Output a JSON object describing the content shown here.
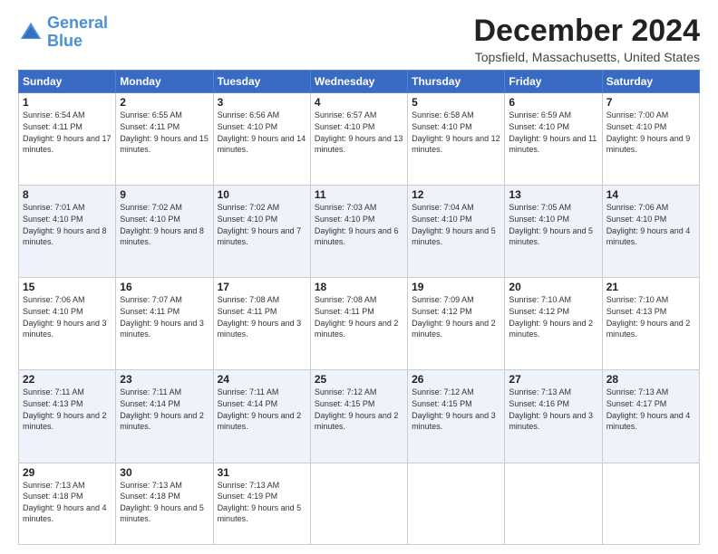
{
  "logo": {
    "line1": "General",
    "line2": "Blue"
  },
  "title": "December 2024",
  "location": "Topsfield, Massachusetts, United States",
  "days_of_week": [
    "Sunday",
    "Monday",
    "Tuesday",
    "Wednesday",
    "Thursday",
    "Friday",
    "Saturday"
  ],
  "weeks": [
    [
      {
        "num": "1",
        "sunrise": "6:54 AM",
        "sunset": "4:11 PM",
        "daylight": "9 hours and 17 minutes."
      },
      {
        "num": "2",
        "sunrise": "6:55 AM",
        "sunset": "4:11 PM",
        "daylight": "9 hours and 15 minutes."
      },
      {
        "num": "3",
        "sunrise": "6:56 AM",
        "sunset": "4:10 PM",
        "daylight": "9 hours and 14 minutes."
      },
      {
        "num": "4",
        "sunrise": "6:57 AM",
        "sunset": "4:10 PM",
        "daylight": "9 hours and 13 minutes."
      },
      {
        "num": "5",
        "sunrise": "6:58 AM",
        "sunset": "4:10 PM",
        "daylight": "9 hours and 12 minutes."
      },
      {
        "num": "6",
        "sunrise": "6:59 AM",
        "sunset": "4:10 PM",
        "daylight": "9 hours and 11 minutes."
      },
      {
        "num": "7",
        "sunrise": "7:00 AM",
        "sunset": "4:10 PM",
        "daylight": "9 hours and 9 minutes."
      }
    ],
    [
      {
        "num": "8",
        "sunrise": "7:01 AM",
        "sunset": "4:10 PM",
        "daylight": "9 hours and 8 minutes."
      },
      {
        "num": "9",
        "sunrise": "7:02 AM",
        "sunset": "4:10 PM",
        "daylight": "9 hours and 8 minutes."
      },
      {
        "num": "10",
        "sunrise": "7:02 AM",
        "sunset": "4:10 PM",
        "daylight": "9 hours and 7 minutes."
      },
      {
        "num": "11",
        "sunrise": "7:03 AM",
        "sunset": "4:10 PM",
        "daylight": "9 hours and 6 minutes."
      },
      {
        "num": "12",
        "sunrise": "7:04 AM",
        "sunset": "4:10 PM",
        "daylight": "9 hours and 5 minutes."
      },
      {
        "num": "13",
        "sunrise": "7:05 AM",
        "sunset": "4:10 PM",
        "daylight": "9 hours and 5 minutes."
      },
      {
        "num": "14",
        "sunrise": "7:06 AM",
        "sunset": "4:10 PM",
        "daylight": "9 hours and 4 minutes."
      }
    ],
    [
      {
        "num": "15",
        "sunrise": "7:06 AM",
        "sunset": "4:10 PM",
        "daylight": "9 hours and 3 minutes."
      },
      {
        "num": "16",
        "sunrise": "7:07 AM",
        "sunset": "4:11 PM",
        "daylight": "9 hours and 3 minutes."
      },
      {
        "num": "17",
        "sunrise": "7:08 AM",
        "sunset": "4:11 PM",
        "daylight": "9 hours and 3 minutes."
      },
      {
        "num": "18",
        "sunrise": "7:08 AM",
        "sunset": "4:11 PM",
        "daylight": "9 hours and 2 minutes."
      },
      {
        "num": "19",
        "sunrise": "7:09 AM",
        "sunset": "4:12 PM",
        "daylight": "9 hours and 2 minutes."
      },
      {
        "num": "20",
        "sunrise": "7:10 AM",
        "sunset": "4:12 PM",
        "daylight": "9 hours and 2 minutes."
      },
      {
        "num": "21",
        "sunrise": "7:10 AM",
        "sunset": "4:13 PM",
        "daylight": "9 hours and 2 minutes."
      }
    ],
    [
      {
        "num": "22",
        "sunrise": "7:11 AM",
        "sunset": "4:13 PM",
        "daylight": "9 hours and 2 minutes."
      },
      {
        "num": "23",
        "sunrise": "7:11 AM",
        "sunset": "4:14 PM",
        "daylight": "9 hours and 2 minutes."
      },
      {
        "num": "24",
        "sunrise": "7:11 AM",
        "sunset": "4:14 PM",
        "daylight": "9 hours and 2 minutes."
      },
      {
        "num": "25",
        "sunrise": "7:12 AM",
        "sunset": "4:15 PM",
        "daylight": "9 hours and 2 minutes."
      },
      {
        "num": "26",
        "sunrise": "7:12 AM",
        "sunset": "4:15 PM",
        "daylight": "9 hours and 3 minutes."
      },
      {
        "num": "27",
        "sunrise": "7:13 AM",
        "sunset": "4:16 PM",
        "daylight": "9 hours and 3 minutes."
      },
      {
        "num": "28",
        "sunrise": "7:13 AM",
        "sunset": "4:17 PM",
        "daylight": "9 hours and 4 minutes."
      }
    ],
    [
      {
        "num": "29",
        "sunrise": "7:13 AM",
        "sunset": "4:18 PM",
        "daylight": "9 hours and 4 minutes."
      },
      {
        "num": "30",
        "sunrise": "7:13 AM",
        "sunset": "4:18 PM",
        "daylight": "9 hours and 5 minutes."
      },
      {
        "num": "31",
        "sunrise": "7:13 AM",
        "sunset": "4:19 PM",
        "daylight": "9 hours and 5 minutes."
      },
      null,
      null,
      null,
      null
    ]
  ]
}
